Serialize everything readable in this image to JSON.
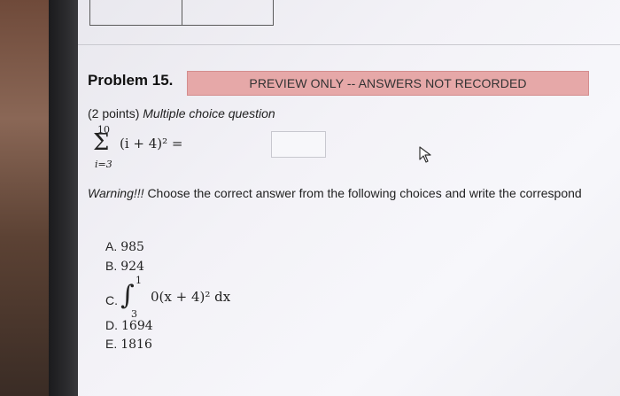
{
  "problem": {
    "title": "Problem 15.",
    "preview_badge": "PREVIEW ONLY -- ANSWERS NOT RECORDED",
    "points": "(2 points)",
    "question_type": "Multiple choice question"
  },
  "summation": {
    "upper": "10",
    "sigma": "Σ",
    "lower": "i=3",
    "term": "(i + 4)² ="
  },
  "answer_input": {
    "value": ""
  },
  "warning": {
    "label": "Warning!!!",
    "text": "Choose the correct answer from the following choices and write the correspond"
  },
  "choices": [
    {
      "letter": "A.",
      "value": "985"
    },
    {
      "letter": "B.",
      "value": "924"
    },
    {
      "letter": "C.",
      "upper": "1",
      "lower": "3",
      "expr": "0(x + 4)² dx",
      "sign": "∫"
    },
    {
      "letter": "D.",
      "value": "1694"
    },
    {
      "letter": "E.",
      "value": "1816"
    }
  ],
  "colors": {
    "badge_bg": "#e6a8a8",
    "screen_bg": "#f3f2f7",
    "text": "#222222"
  },
  "icons": {
    "cursor": "mouse-pointer-icon"
  }
}
